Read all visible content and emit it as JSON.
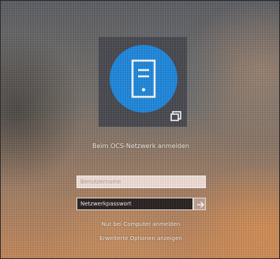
{
  "login": {
    "signin_label": "Beim OCS-Netzwerk anmelden",
    "username_placeholder": "Benutzername",
    "password_placeholder": "Netzwerkpasswort",
    "local_signin_link": "Nur bei Computer anmelden",
    "advanced_options_link": "Erweiterte Optionen anzeigen"
  },
  "icons": {
    "avatar": "server-tower-icon",
    "corner": "network-user-icon",
    "submit": "arrow-right-icon"
  },
  "colors": {
    "avatar_blue": "#1f8ae0",
    "tile_background": "#4a4a52"
  }
}
